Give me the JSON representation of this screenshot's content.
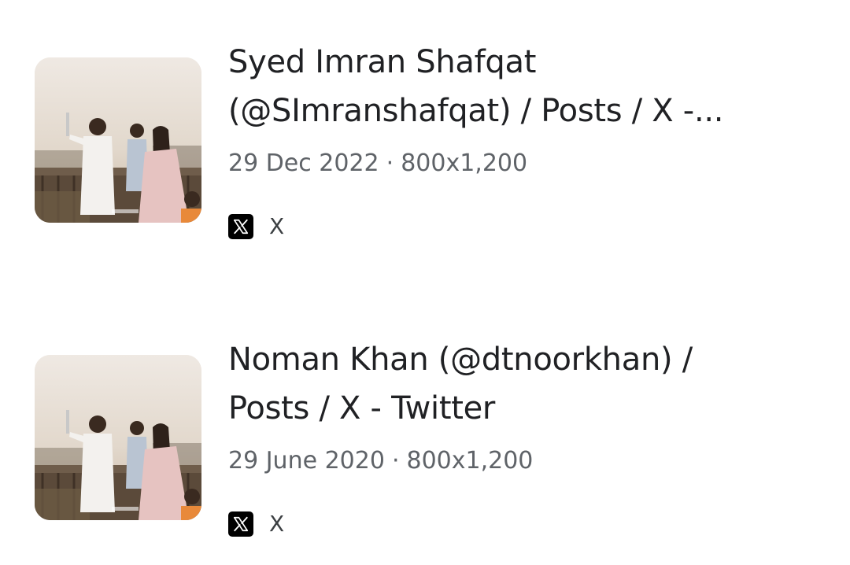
{
  "results": [
    {
      "title_line1": "Syed Imran Shafqat",
      "title_line2": "(@SImranshafqat) / Posts / X -...",
      "date": "29 Dec 2022",
      "separator": "·",
      "dimensions": "800x1,200",
      "site_name": "X",
      "favicon": "x-logo-icon"
    },
    {
      "title_line1": "Noman Khan (@dtnoorkhan) /",
      "title_line2": "Posts / X - Twitter",
      "date": "29 June 2020",
      "separator": "·",
      "dimensions": "800x1,200",
      "site_name": "X",
      "favicon": "x-logo-icon"
    }
  ]
}
